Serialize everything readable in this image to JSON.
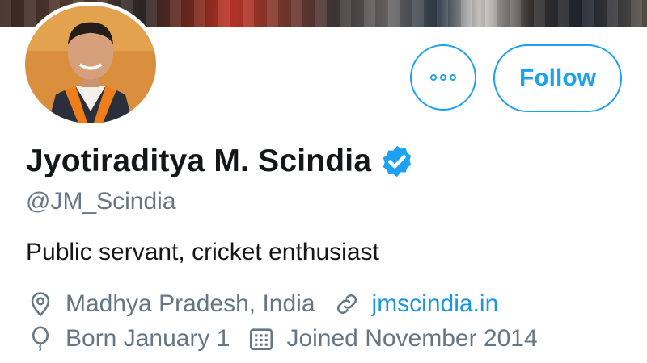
{
  "colors": {
    "accent": "#1da1f2",
    "link": "#1b95e0",
    "secondary_text": "#657786",
    "primary_text": "#14171a",
    "verified_badge": "#1da1f2"
  },
  "header": {
    "banner_icon": "banner-photo",
    "avatar_icon": "profile-photo"
  },
  "actions": {
    "more_icon": "more-options-icon",
    "follow_label": "Follow"
  },
  "profile": {
    "name": "Jyotiraditya M. Scindia",
    "verified_icon": "verified-badge-icon",
    "handle": "@JM_Scindia",
    "bio": "Public servant, cricket enthusiast"
  },
  "meta": {
    "location_icon": "location-pin-icon",
    "location": "Madhya Pradesh, India",
    "link_icon": "link-icon",
    "website": "jmscindia.in",
    "birthday_icon": "balloon-icon",
    "birthday": "Born January 1",
    "joined_icon": "calendar-icon",
    "joined": "Joined November 2014"
  }
}
